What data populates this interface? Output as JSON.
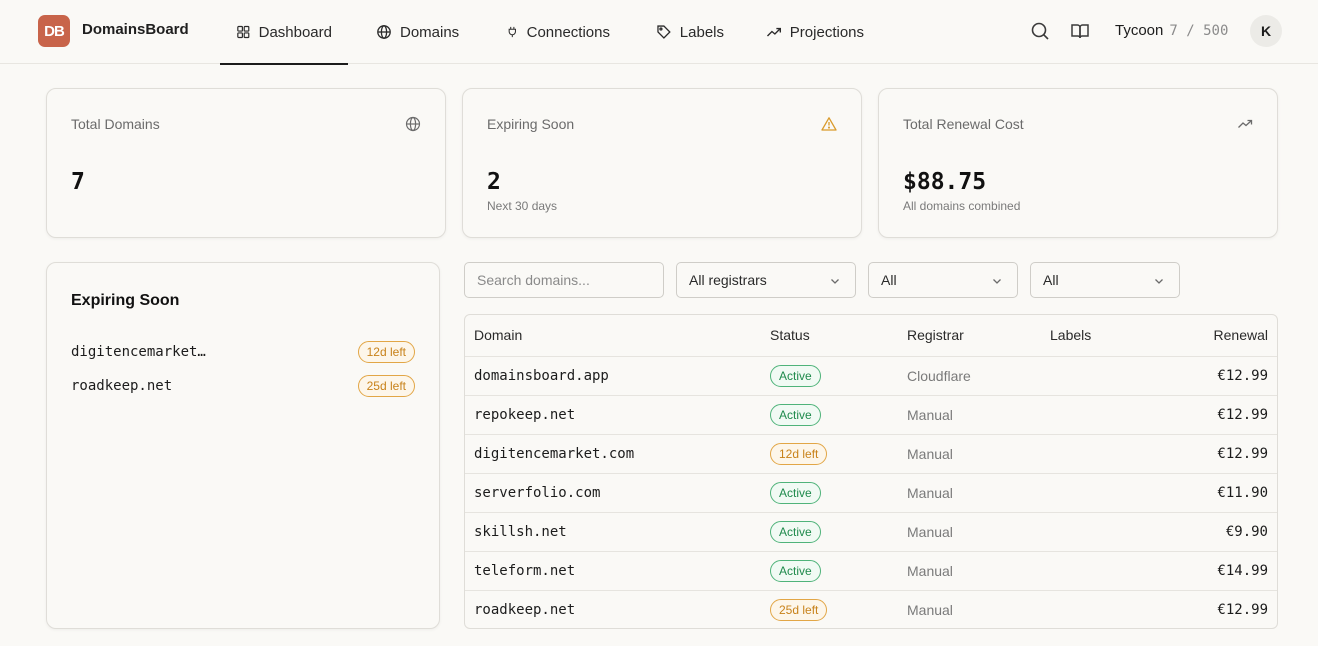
{
  "app": {
    "brand": "DomainsBoard",
    "logo_text": "DB",
    "accent_color": "#c8644a"
  },
  "nav": {
    "items": [
      {
        "label": "Dashboard",
        "icon": "grid-icon",
        "active": true
      },
      {
        "label": "Domains",
        "icon": "globe-icon"
      },
      {
        "label": "Connections",
        "icon": "plug-icon"
      },
      {
        "label": "Labels",
        "icon": "tag-icon"
      },
      {
        "label": "Projections",
        "icon": "trending-up-icon"
      }
    ]
  },
  "header": {
    "plan_name": "Tycoon",
    "plan_usage": "7 / 500",
    "avatar_initial": "K",
    "icons": [
      "search-icon",
      "book-icon"
    ]
  },
  "stats": [
    {
      "label": "Total Domains",
      "value": "7",
      "sub": "",
      "icon": "globe-icon"
    },
    {
      "label": "Expiring Soon",
      "value": "2",
      "sub": "Next 30 days",
      "icon": "warning-icon"
    },
    {
      "label": "Total Renewal Cost",
      "value": "$88.75",
      "sub": "All domains combined",
      "icon": "trending-up-icon"
    }
  ],
  "expiring": {
    "title": "Expiring Soon",
    "items": [
      {
        "name": "digitencemarket…",
        "badge": "12d left"
      },
      {
        "name": "roadkeep.net",
        "badge": "25d left"
      }
    ]
  },
  "filters": {
    "search_placeholder": "Search domains...",
    "registrar": "All registrars",
    "status": "All",
    "label": "All"
  },
  "table": {
    "headers": [
      "Domain",
      "Status",
      "Registrar",
      "Labels",
      "Renewal"
    ],
    "rows": [
      {
        "domain": "domainsboard.app",
        "status": "Active",
        "status_type": "ok",
        "registrar": "Cloudflare",
        "labels": "",
        "renewal": "€12.99"
      },
      {
        "domain": "repokeep.net",
        "status": "Active",
        "status_type": "ok",
        "registrar": "Manual",
        "labels": "",
        "renewal": "€12.99"
      },
      {
        "domain": "digitencemarket.com",
        "status": "12d left",
        "status_type": "warn",
        "registrar": "Manual",
        "labels": "",
        "renewal": "€12.99"
      },
      {
        "domain": "serverfolio.com",
        "status": "Active",
        "status_type": "ok",
        "registrar": "Manual",
        "labels": "",
        "renewal": "€11.90"
      },
      {
        "domain": "skillsh.net",
        "status": "Active",
        "status_type": "ok",
        "registrar": "Manual",
        "labels": "",
        "renewal": "€9.90"
      },
      {
        "domain": "teleform.net",
        "status": "Active",
        "status_type": "ok",
        "registrar": "Manual",
        "labels": "",
        "renewal": "€14.99"
      },
      {
        "domain": "roadkeep.net",
        "status": "25d left",
        "status_type": "warn",
        "registrar": "Manual",
        "labels": "",
        "renewal": "€12.99"
      }
    ]
  }
}
